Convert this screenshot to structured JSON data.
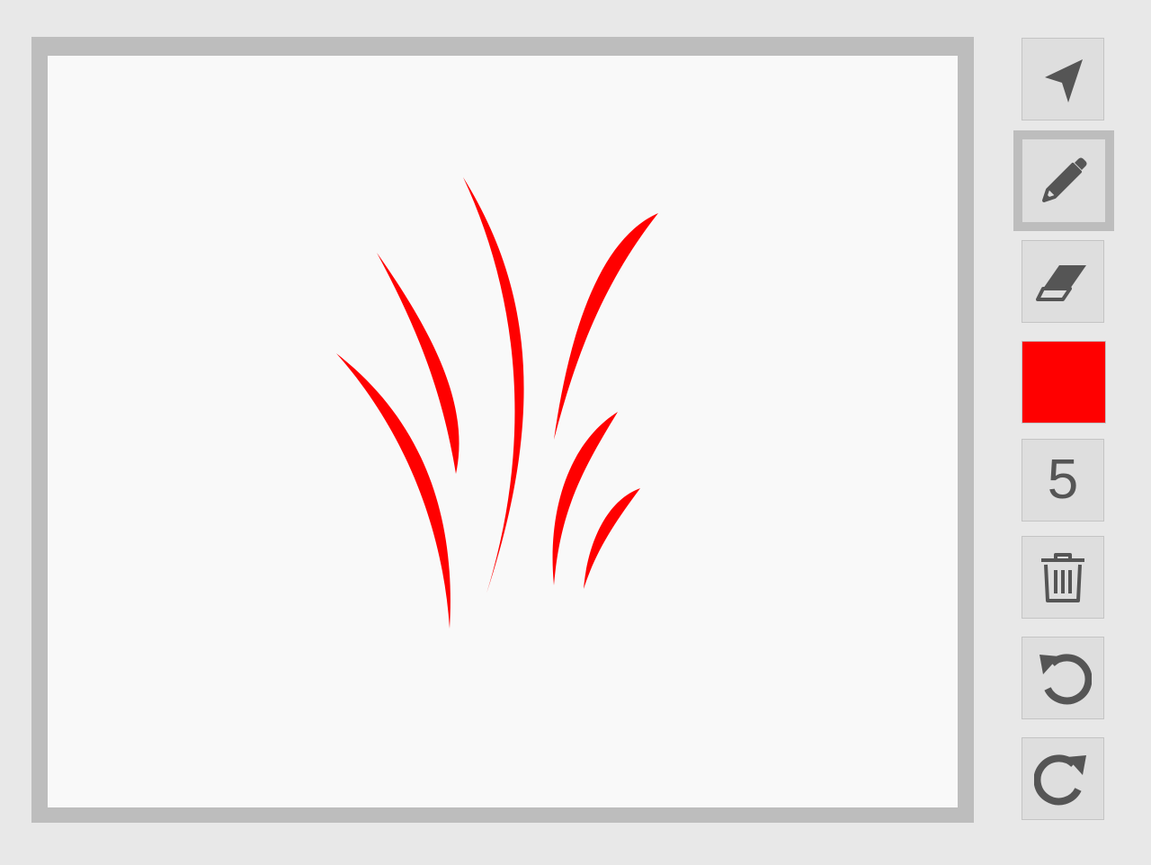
{
  "toolbar": {
    "tools": [
      {
        "name": "select-tool",
        "icon": "navigation-arrow-icon"
      },
      {
        "name": "pencil-tool",
        "icon": "pencil-icon",
        "active": true
      },
      {
        "name": "eraser-tool",
        "icon": "eraser-icon"
      }
    ],
    "color": "#ff0000",
    "brush_size": "5",
    "actions": [
      {
        "name": "clear-button",
        "icon": "trash-icon"
      },
      {
        "name": "undo-button",
        "icon": "undo-icon"
      },
      {
        "name": "redo-button",
        "icon": "redo-icon"
      }
    ],
    "icon_color": "#555555"
  },
  "canvas": {
    "background": "#f9f9f9",
    "stroke_color": "#ff0000",
    "drawing": "grass-blades"
  }
}
